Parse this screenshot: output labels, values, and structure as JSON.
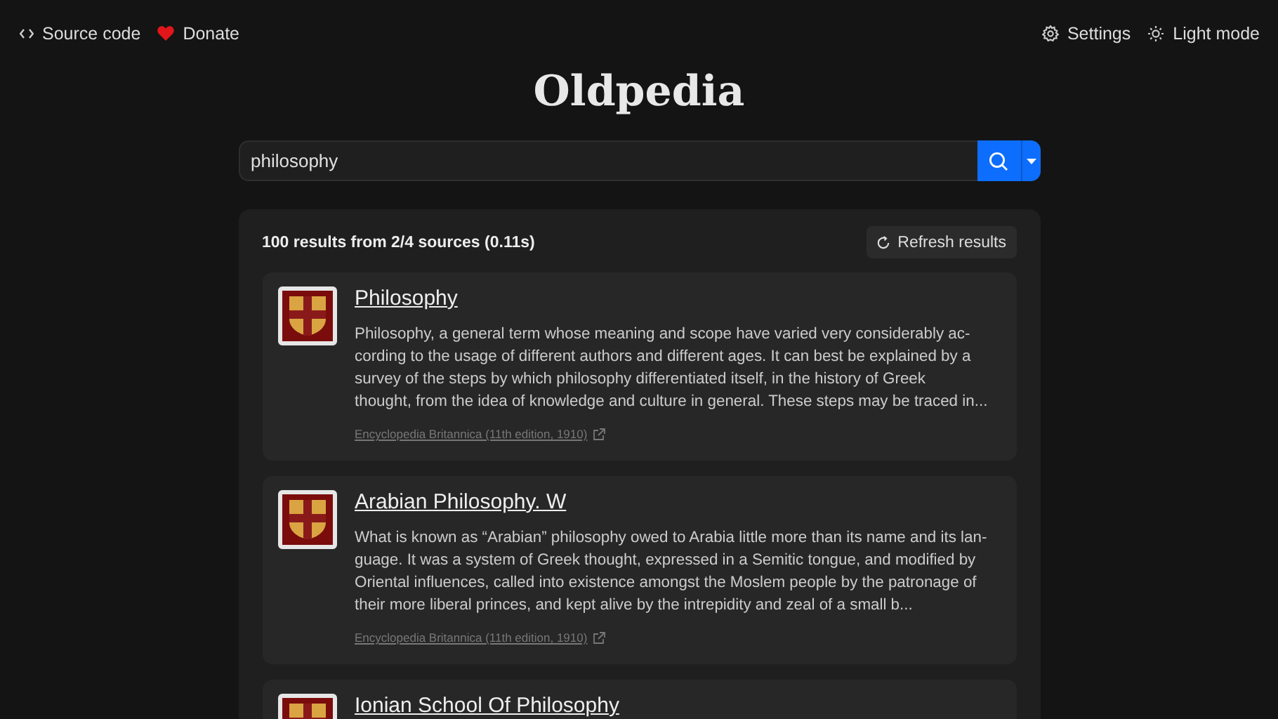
{
  "nav": {
    "left": [
      {
        "kind": "code",
        "label": "Source code"
      },
      {
        "kind": "heart",
        "label": "Donate"
      }
    ],
    "right": [
      {
        "kind": "gear",
        "label": "Settings"
      },
      {
        "kind": "sun",
        "label": "Light mode"
      }
    ]
  },
  "logo": "Oldpedia",
  "search": {
    "value": "philosophy"
  },
  "results": {
    "summary": "100 results from 2/4 sources (0.11s)",
    "refresh": "Refresh results",
    "items": [
      {
        "title": "Philosophy",
        "snippet": "Philosophy, a general term whose meaning and scope have varied very considerably ac-\ncording to the usage of different authors and different ages. It can best be explained by a\nsurvey of the steps by which philosophy differentiated itself, in the history of Greek\nthought, from the idea of knowledge and culture in general. These steps may be traced in...",
        "source": "Encyclopedia Britannica (11th edition, 1910)"
      },
      {
        "title": "Arabian Philosophy. W",
        "snippet": "What is known as “Arabian” philosophy owed to Arabia little more than its name and its lan-\nguage. It was a system of Greek thought, expressed in a Semitic tongue, and modified by\nOriental influences, called into existence amongst the Moslem people by the patronage of\ntheir more liberal princes, and kept alive by the intrepidity and zeal of a small b...",
        "source": "Encyclopedia Britannica (11th edition, 1910)"
      },
      {
        "title": "Ionian School Of Philosophy"
      }
    ]
  }
}
